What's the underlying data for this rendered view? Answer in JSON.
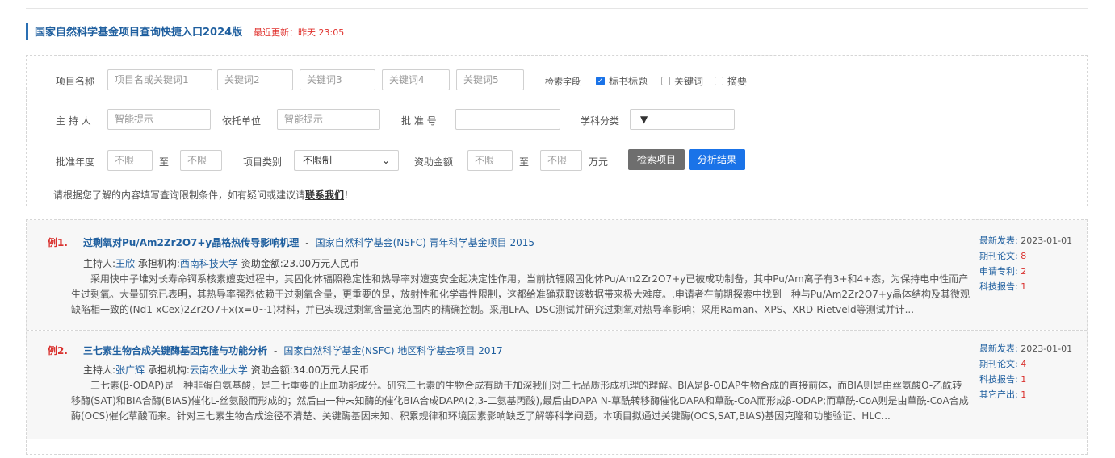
{
  "header": {
    "title": "国家自然科学基金项目查询快捷入口2024版",
    "update": "最近更新：昨天 23:05"
  },
  "form": {
    "project_name_label": "项目名称",
    "keyword1_placeholder": "项目名或关键词1",
    "keyword2_placeholder": "关键词2",
    "keyword3_placeholder": "关键词3",
    "keyword4_placeholder": "关键词4",
    "keyword5_placeholder": "关键词5",
    "search_field_label": "检索字段",
    "checkboxes": [
      {
        "label": "标书标题",
        "checked": true
      },
      {
        "label": "关键词",
        "checked": false
      },
      {
        "label": "摘要",
        "checked": false
      }
    ],
    "host_label": "主 持 人",
    "host_placeholder": "智能提示",
    "org_label": "依托单位",
    "org_placeholder": "智能提示",
    "approval_label": "批 准 号",
    "approval_value": "",
    "subject_label": "学科分类",
    "subject_value": "▼",
    "year_label": "批准年度",
    "year_from": "不限",
    "to_label": "至",
    "year_to": "不限",
    "category_label": "项目类别",
    "category_value": "不限制",
    "amount_label": "资助金额",
    "amount_from": "不限",
    "amount_to": "不限",
    "amount_unit": "万元",
    "search_button": "检索项目",
    "analyze_button": "分析结果",
    "note_prefix": "请根据您了解的内容填写查询限制条件，如有疑问或建议请",
    "note_link": "联系我们",
    "note_suffix": "！"
  },
  "results": [
    {
      "index": "例1.",
      "title": "过剩氧对Pu/Am2Zr2O7+y晶格热传导影响机理",
      "dash": "-",
      "source": "国家自然科学基金(NSFC) 青年科学基金项目 2015",
      "host_prefix": "主持人:",
      "host": "王欣",
      "org_prefix": " 承担机构:",
      "org": "西南科技大学",
      "funding": " 资助金额:23.00万元人民币",
      "abstract": "采用快中子堆对长寿命锕系核素嬗变过程中，其固化体辐照稳定性和热导率对嬗变安全起决定性作用，当前抗辐照固化体Pu/Am2Zr2O7+y已被成功制备，其中Pu/Am离子有3+和4+态，为保持电中性而产生过剩氧。大量研究已表明，其热导率强烈依赖于过剩氧含量，更重要的是，放射性和化学毒性限制，这都给准确获取该数据带来极大难度。.申请者在前期探索中找到一种与Pu/Am2Zr2O7+y晶体结构及其微观缺陷相一致的(Nd1-xCex)2Zr2O7+x(x=0~1)材料，并已实现过剩氧含量宽范围内的精确控制。采用LFA、DSC测试并研究过剩氧对热导率影响；采用Raman、XPS、XRD-Rietveld等测试并计...",
      "stats": [
        {
          "k": "最新发表:",
          "v": "2023-01-01"
        },
        {
          "k": "期刊论文:",
          "v": "8"
        },
        {
          "k": "申请专利:",
          "v": "2"
        },
        {
          "k": "科技报告:",
          "v": "1"
        }
      ]
    },
    {
      "index": "例2.",
      "title": "三七素生物合成关键酶基因克隆与功能分析",
      "dash": "-",
      "source": "国家自然科学基金(NSFC) 地区科学基金项目 2017",
      "host_prefix": "主持人:",
      "host": "张广辉",
      "org_prefix": " 承担机构:",
      "org": "云南农业大学",
      "funding": " 资助金额:34.00万元人民币",
      "abstract": "三七素(β-ODAP)是一种非蛋白氨基酸，是三七重要的止血功能成分。研究三七素的生物合成有助于加深我们对三七品质形成机理的理解。BIA是β-ODAP生物合成的直接前体，而BIA则是由丝氨酸O-乙酰转移酶(SAT)和BIA合酶(BIAS)催化L-丝氨酸而形成的；然后由一种未知酶的催化BIA合成DAPA(2,3-二氨基丙酸),最后由DAPA N-草酰转移酶催化DAPA和草酰-CoA而形成β-ODAP;而草酰-CoA则是由草酰-CoA合成酶(OCS)催化草酸而来。针对三七素生物合成途径不清楚、关键酶基因未知、积累规律和环境因素影响缺乏了解等科学问题，本项目拟通过关键酶(OCS,SAT,BIAS)基因克隆和功能验证、HLC...",
      "stats": [
        {
          "k": "最新发表:",
          "v": "2023-01-01"
        },
        {
          "k": "期刊论文:",
          "v": "4"
        },
        {
          "k": "科技报告:",
          "v": "1"
        },
        {
          "k": "其它产出:",
          "v": "1"
        }
      ]
    }
  ]
}
